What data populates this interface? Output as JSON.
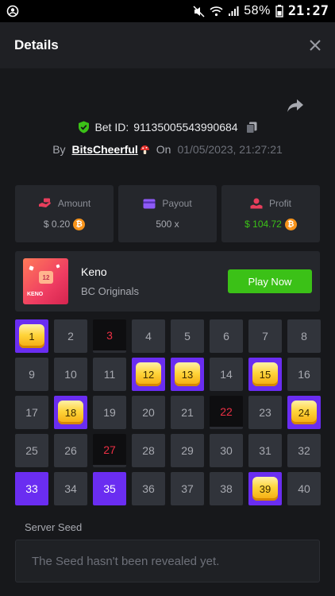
{
  "statusbar": {
    "battery": "58%",
    "time": "21:27"
  },
  "header": {
    "title": "Details"
  },
  "bet": {
    "id_label": "Bet ID:",
    "id_value": "91135005543990684",
    "by_label": "By",
    "username": "BitsCheerful",
    "on_label": "On",
    "datetime": "01/05/2023, 21:27:21"
  },
  "stats": {
    "amount_label": "Amount",
    "amount_value": "$ 0.20",
    "payout_label": "Payout",
    "payout_value": "500 x",
    "profit_label": "Profit",
    "profit_value": "$ 104.72"
  },
  "game": {
    "name": "Keno",
    "provider": "BC Originals",
    "play_label": "Play Now",
    "thumb_number": "12",
    "thumb_tag": "KENO"
  },
  "grid": [
    {
      "n": "1",
      "s": "hit"
    },
    {
      "n": "2",
      "s": "normal"
    },
    {
      "n": "3",
      "s": "miss"
    },
    {
      "n": "4",
      "s": "normal"
    },
    {
      "n": "5",
      "s": "normal"
    },
    {
      "n": "6",
      "s": "normal"
    },
    {
      "n": "7",
      "s": "normal"
    },
    {
      "n": "8",
      "s": "normal"
    },
    {
      "n": "9",
      "s": "normal"
    },
    {
      "n": "10",
      "s": "normal"
    },
    {
      "n": "11",
      "s": "normal"
    },
    {
      "n": "12",
      "s": "hit"
    },
    {
      "n": "13",
      "s": "hit"
    },
    {
      "n": "14",
      "s": "normal"
    },
    {
      "n": "15",
      "s": "hit"
    },
    {
      "n": "16",
      "s": "normal"
    },
    {
      "n": "17",
      "s": "normal"
    },
    {
      "n": "18",
      "s": "hit"
    },
    {
      "n": "19",
      "s": "normal"
    },
    {
      "n": "20",
      "s": "normal"
    },
    {
      "n": "21",
      "s": "normal"
    },
    {
      "n": "22",
      "s": "miss"
    },
    {
      "n": "23",
      "s": "normal"
    },
    {
      "n": "24",
      "s": "hit"
    },
    {
      "n": "25",
      "s": "normal"
    },
    {
      "n": "26",
      "s": "normal"
    },
    {
      "n": "27",
      "s": "miss"
    },
    {
      "n": "28",
      "s": "normal"
    },
    {
      "n": "29",
      "s": "normal"
    },
    {
      "n": "30",
      "s": "normal"
    },
    {
      "n": "31",
      "s": "normal"
    },
    {
      "n": "32",
      "s": "normal"
    },
    {
      "n": "33",
      "s": "pick"
    },
    {
      "n": "34",
      "s": "normal"
    },
    {
      "n": "35",
      "s": "pick"
    },
    {
      "n": "36",
      "s": "normal"
    },
    {
      "n": "37",
      "s": "normal"
    },
    {
      "n": "38",
      "s": "normal"
    },
    {
      "n": "39",
      "s": "hit"
    },
    {
      "n": "40",
      "s": "normal"
    }
  ],
  "seed": {
    "label": "Server Seed",
    "text": "The Seed hasn't been revealed yet."
  },
  "colors": {
    "accent_green": "#3bc117",
    "pick_purple": "#6a2df1",
    "miss_red": "#ec2f44",
    "bitcoin": "#f7931a"
  }
}
